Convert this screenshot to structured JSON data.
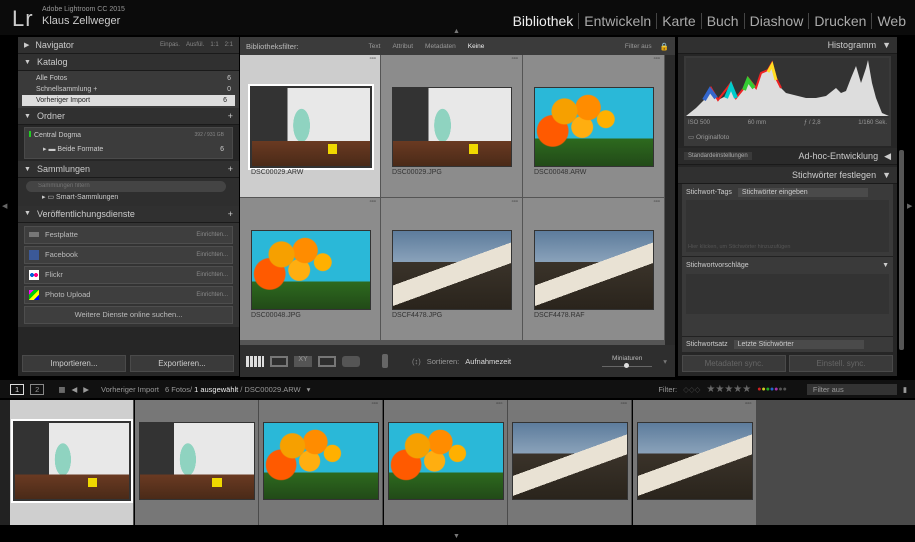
{
  "app": {
    "logo": "Lr",
    "name": "Adobe Lightroom CC 2015",
    "user": "Klaus Zellweger"
  },
  "modules": [
    "Bibliothek",
    "Entwickeln",
    "Karte",
    "Buch",
    "Diashow",
    "Drucken",
    "Web"
  ],
  "left": {
    "navigator": {
      "title": "Navigator",
      "zoom": [
        "Einpas.",
        "Ausfül.",
        "1:1",
        "2:1"
      ]
    },
    "katalog": {
      "title": "Katalog",
      "items": [
        {
          "label": "Alle Fotos",
          "count": "6"
        },
        {
          "label": "Schnellsammlung +",
          "count": "0"
        },
        {
          "label": "Vorheriger Import",
          "count": "6"
        }
      ]
    },
    "ordner": {
      "title": "Ordner",
      "volume": "Central Dogma",
      "volume_size": "392 / 931 GB",
      "folder": "Beide Formate",
      "folder_count": "6"
    },
    "sammlungen": {
      "title": "Sammlungen",
      "search_placeholder": "Sammlungen filtern",
      "smart": "Smart-Sammlungen"
    },
    "publish": {
      "title": "Veröffentlichungsdienste",
      "services": [
        {
          "label": "Festplatte",
          "action": "Einrichten..."
        },
        {
          "label": "Facebook",
          "action": "Einrichten..."
        },
        {
          "label": "Flickr",
          "action": "Einrichten..."
        },
        {
          "label": "Photo Upload",
          "action": "Einrichten..."
        }
      ],
      "more": "Weitere Dienste online suchen..."
    },
    "import": "Importieren...",
    "export": "Exportieren..."
  },
  "filterbar": {
    "label": "Bibliotheksfilter:",
    "tabs": [
      "Text",
      "Attribut",
      "Metadaten",
      "Keine"
    ],
    "active": "Keine",
    "state": "Filter aus"
  },
  "photos": [
    {
      "name": "DSC00029.ARW",
      "kind": "cup",
      "selected": true
    },
    {
      "name": "DSC00029.JPG",
      "kind": "cup"
    },
    {
      "name": "DSC00048.ARW",
      "kind": "flow"
    },
    {
      "name": "DSC00048.JPG",
      "kind": "flow"
    },
    {
      "name": "DSCF4478.JPG",
      "kind": "house"
    },
    {
      "name": "DSCF4478.RAF",
      "kind": "house"
    }
  ],
  "toolbar": {
    "sort_label": "Sortieren:",
    "sort_value": "Aufnahmezeit",
    "thumb_label": "Miniaturen"
  },
  "right": {
    "histogram": {
      "title": "Histogramm",
      "iso": "ISO 500",
      "focal": "60 mm",
      "aperture": "ƒ / 2,8",
      "shutter": "1/160 Sek.",
      "original": "Originalfoto"
    },
    "preset": "Standardeinstellungen",
    "quick_develop": "Ad-hoc-Entwicklung",
    "keywording": {
      "title": "Stichwörter festlegen",
      "tags_label": "Stichwort-Tags",
      "tags_placeholder": "Stichwörter eingeben",
      "hint": "Hier klicken, um Stichwörter hinzuzufügen",
      "suggestions": "Stichwortvorschläge",
      "set_label": "Stichwortsatz",
      "set_value": "Letzte Stichwörter"
    },
    "sync_meta": "Metadaten sync.",
    "sync_settings": "Einstell. sync."
  },
  "filmstrip": {
    "pages": [
      "1",
      "2"
    ],
    "source": "Vorheriger Import",
    "count": "6 Fotos/",
    "selected": "1 ausgewählt",
    "file": "/ DSC00029.ARW",
    "filter_label": "Filter:",
    "filter_value": "Filter aus"
  }
}
